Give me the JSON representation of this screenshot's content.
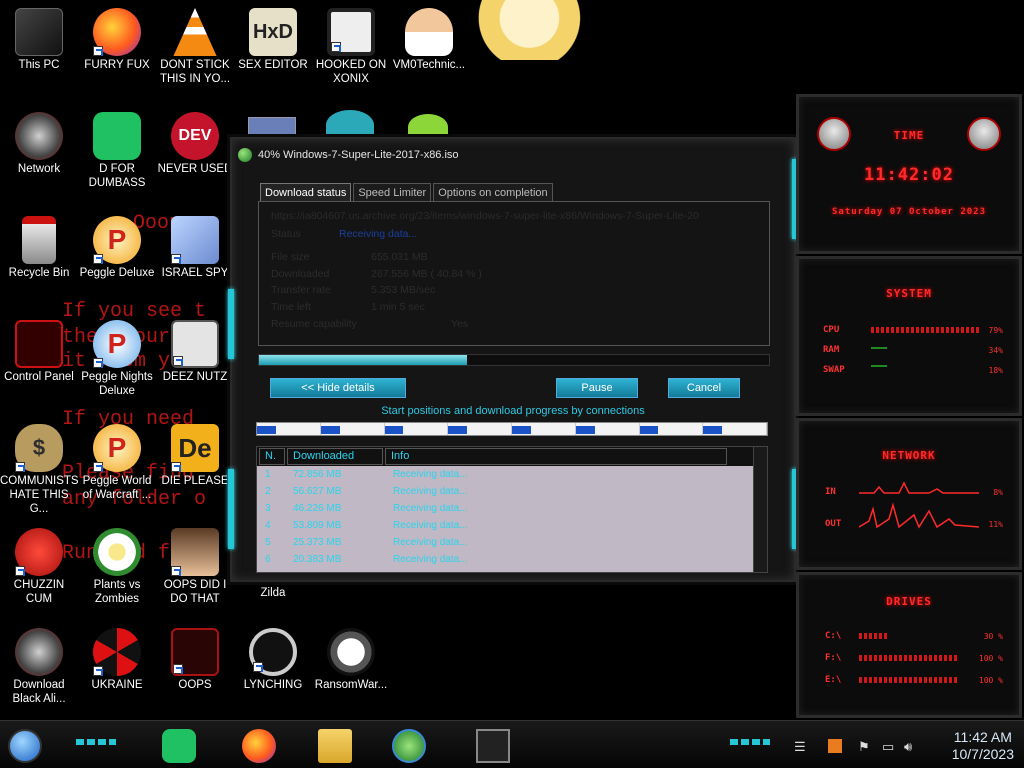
{
  "desktop": {
    "background_text": [
      "Ooops",
      "If you see t",
      "then your",
      "it from your",
      "If you need",
      "Please find",
      "any folder o",
      "Run and fo"
    ],
    "icons": [
      {
        "label": "This PC",
        "icon": "computer-icon"
      },
      {
        "label": "FURRY FUX",
        "icon": "firefox-icon"
      },
      {
        "label": "DONT STICK THIS IN YO...",
        "icon": "vlc-cone-icon"
      },
      {
        "label": "SEX EDITOR",
        "icon": "hxd-icon"
      },
      {
        "label": "HOOKED ON XONIX",
        "icon": "xonix-icon"
      },
      {
        "label": "VM0Technic...",
        "icon": "doctor-icon"
      },
      {
        "label": "Network",
        "icon": "alien-network-icon"
      },
      {
        "label": "D FOR DUMBASS",
        "icon": "green-chat-icon"
      },
      {
        "label": "NEVER USED",
        "icon": "dev-icon"
      },
      {
        "label": "Recycle Bin",
        "icon": "recycle-bin-icon"
      },
      {
        "label": "Peggle Deluxe",
        "icon": "peggle-icon"
      },
      {
        "label": "ISRAEL SPY",
        "icon": "spy-icon"
      },
      {
        "label": "Control Panel",
        "icon": "control-panel-icon"
      },
      {
        "label": "Peggle Nights Deluxe",
        "icon": "peggle-nights-icon"
      },
      {
        "label": "DEEZ NUTZ",
        "icon": "windows-stack-icon"
      },
      {
        "label": "COMMUNISTS HATE THIS G...",
        "icon": "money-bag-icon"
      },
      {
        "label": "Peggle World of Warcraft ...",
        "icon": "peggle-wow-icon"
      },
      {
        "label": "DIE PLEASE",
        "icon": "de-icon"
      },
      {
        "label": "CHUZZIN CUM",
        "icon": "chuzzle-icon"
      },
      {
        "label": "Plants vs Zombies",
        "icon": "flower-icon"
      },
      {
        "label": "OOPS DID I DO THAT",
        "icon": "portrait-icon"
      },
      {
        "label": "Zilda",
        "icon": "zilda-icon"
      },
      {
        "label": "Download Black Ali...",
        "icon": "alien-download-icon"
      },
      {
        "label": "UKRAINE",
        "icon": "radiation-icon"
      },
      {
        "label": "OOPS",
        "icon": "oops-icon"
      },
      {
        "label": "LYNCHING",
        "icon": "lynching-icon"
      },
      {
        "label": "RansomWar...",
        "icon": "skull-icon"
      }
    ]
  },
  "idm": {
    "title": "40% Windows-7-Super-Lite-2017-x86.iso",
    "tabs": [
      "Download status",
      "Speed Limiter",
      "Options on completion"
    ],
    "url": "https://ia804607.us.archive.org/23/items/windows-7-super-lite-x86/Windows-7-Super-Lite-20",
    "status_label": "Status",
    "status_value": "Receiving data...",
    "file_size_label": "File size",
    "file_size": "655.031 MB",
    "downloaded_label": "Downloaded",
    "downloaded": "267.556 MB  ( 40.84 % )",
    "transfer_rate_label": "Transfer rate",
    "transfer_rate": "5.353 MB/sec",
    "time_left_label": "Time left",
    "time_left": "1 min 5 sec",
    "resume_label": "Resume capability",
    "resume": "Yes",
    "progress": 0.4084,
    "hide_details": "<< Hide details",
    "pause": "Pause",
    "cancel": "Cancel",
    "connections_title": "Start positions and download progress by connections",
    "table_headers": [
      "N.",
      "Downloaded",
      "Info"
    ],
    "rows": [
      {
        "n": "1",
        "downloaded": "72.856 MB",
        "info": "Receiving data..."
      },
      {
        "n": "2",
        "downloaded": "56.627 MB",
        "info": "Receiving data..."
      },
      {
        "n": "3",
        "downloaded": "46.226 MB",
        "info": "Receiving data..."
      },
      {
        "n": "4",
        "downloaded": "53.809 MB",
        "info": "Receiving data..."
      },
      {
        "n": "5",
        "downloaded": "25.373 MB",
        "info": "Receiving data..."
      },
      {
        "n": "6",
        "downloaded": "20.383 MB",
        "info": "Receiving data..."
      }
    ]
  },
  "gadget": {
    "time_title": "TIME",
    "time": "11:42:02",
    "date": "Saturday 07 October 2023",
    "system_title": "SYSTEM",
    "cpu_label": "CPU",
    "cpu": "79%",
    "ram_label": "RAM",
    "ram": "34%",
    "swap_label": "SWAP",
    "swap": "18%",
    "network_title": "NETWORK",
    "in_label": "IN",
    "in": "8%",
    "out_label": "OUT",
    "out": "11%",
    "drives_title": "DRIVES",
    "drives": [
      {
        "label": "C:\\",
        "value": "30 %"
      },
      {
        "label": "F:\\",
        "value": "100 %"
      },
      {
        "label": "E:\\",
        "value": "100 %"
      }
    ]
  },
  "taskbar": {
    "time": "11:42 AM",
    "date": "10/7/2023"
  }
}
